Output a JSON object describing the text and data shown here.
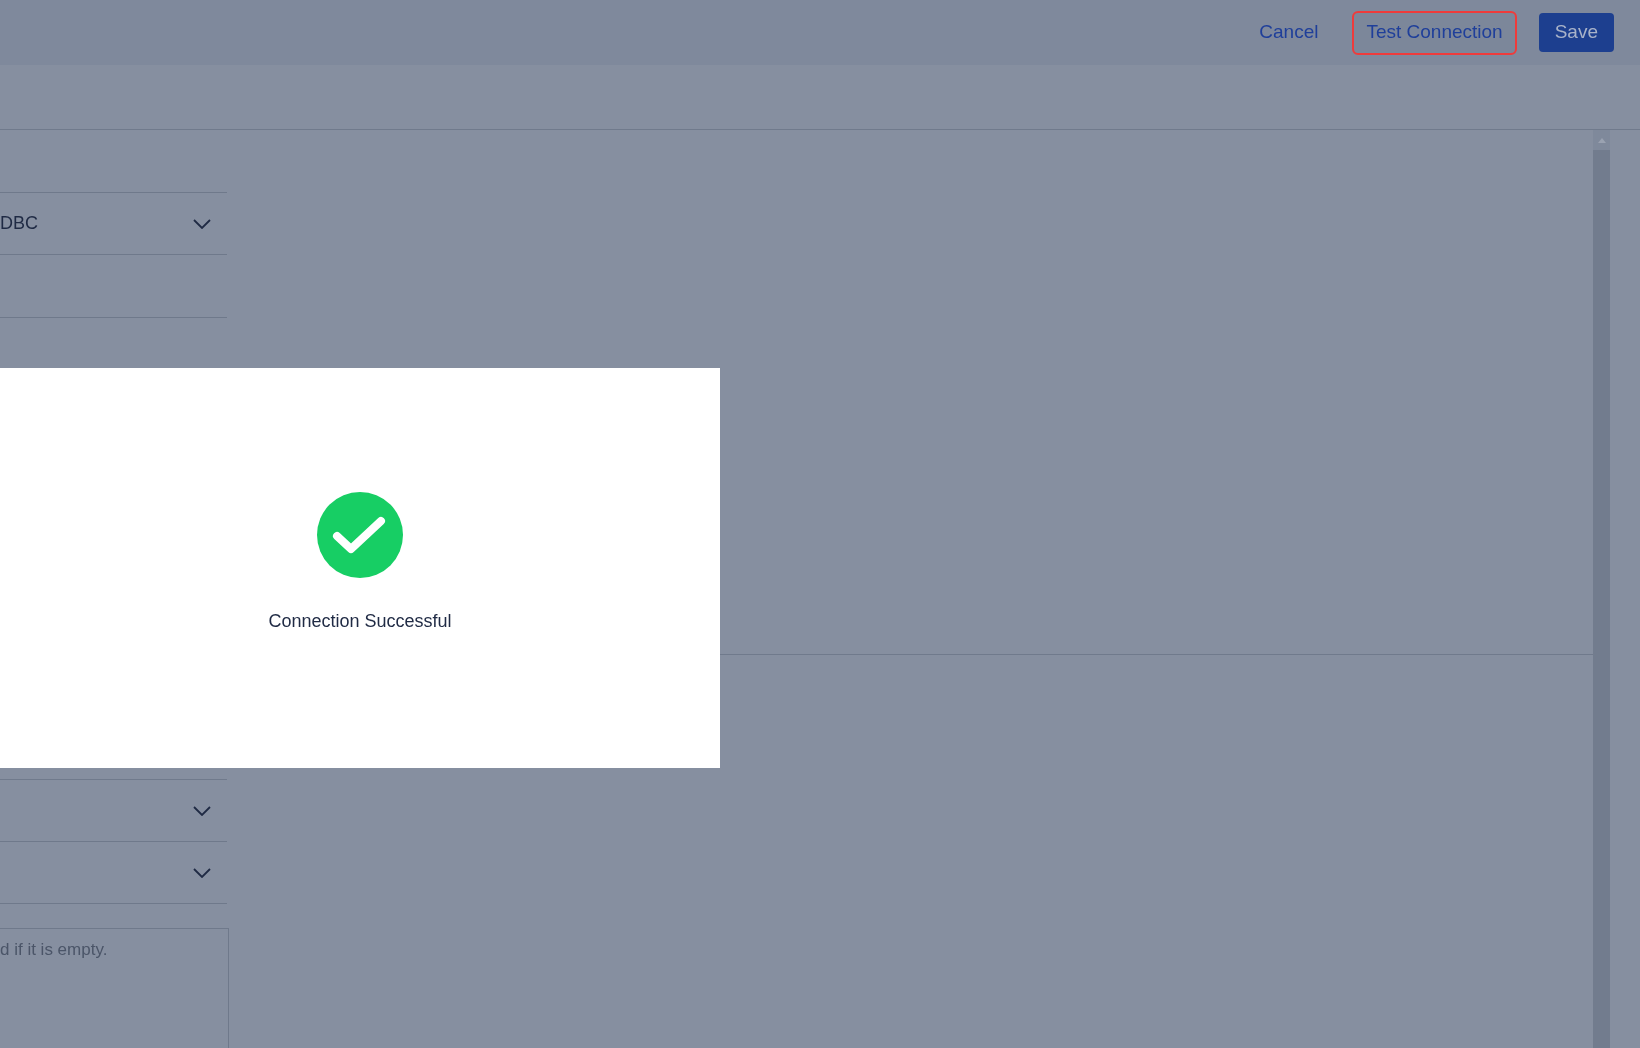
{
  "header": {
    "buttons": [
      {
        "label": "Cancel",
        "kind": "link",
        "highlighted": false
      },
      {
        "label": "Test Connection",
        "kind": "secondary",
        "highlighted": true
      },
      {
        "label": "Save",
        "kind": "primary",
        "highlighted": false
      }
    ]
  },
  "form": {
    "fields": [
      {
        "kind": "text"
      },
      {
        "kind": "select",
        "value": "DBC"
      },
      {
        "kind": "text"
      }
    ],
    "lower_fields": [
      {
        "kind": "select"
      },
      {
        "kind": "select"
      },
      {
        "kind": "textarea",
        "placeholder": "d if it is empty."
      }
    ]
  },
  "dialog": {
    "kind": "success",
    "message": "Connection Successful"
  }
}
